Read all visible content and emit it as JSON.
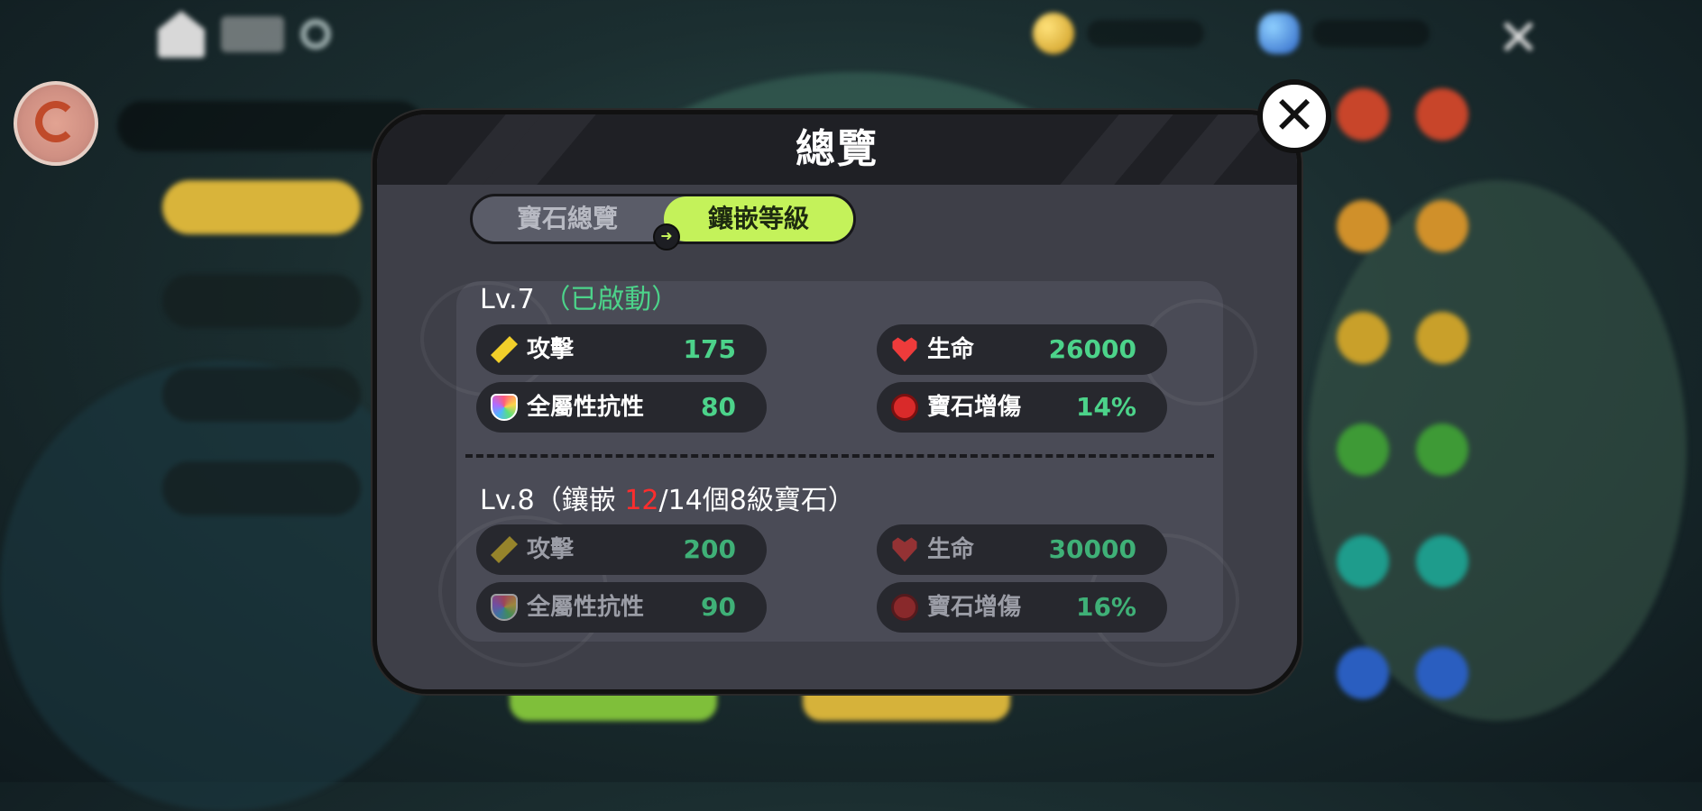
{
  "modal": {
    "title": "總覽",
    "tabs": [
      {
        "label": "寶石總覽",
        "active": false
      },
      {
        "label": "鑲嵌等級",
        "active": true
      }
    ]
  },
  "level7": {
    "level": "Lv.7",
    "status": "（已啟動）",
    "stats": {
      "attack": {
        "name": "攻擊",
        "value": "175"
      },
      "hp": {
        "name": "生命",
        "value": "26000"
      },
      "resist": {
        "name": "全屬性抗性",
        "value": "80"
      },
      "gem_damage": {
        "name": "寶石增傷",
        "value": "14%"
      }
    }
  },
  "level8": {
    "level": "Lv.8",
    "progress_prefix": "（鑲嵌 ",
    "progress_current": "12",
    "progress_suffix": "/14個8級寶石）",
    "stats": {
      "attack": {
        "name": "攻擊",
        "value": "200"
      },
      "hp": {
        "name": "生命",
        "value": "30000"
      },
      "resist": {
        "name": "全屬性抗性",
        "value": "90"
      },
      "gem_damage": {
        "name": "寶石增傷",
        "value": "16%"
      }
    }
  },
  "colors": {
    "active_tab": "#c4f25a",
    "value_green": "#4cd38a",
    "progress_red": "#ff2d2d",
    "panel": "#3e3f48"
  }
}
